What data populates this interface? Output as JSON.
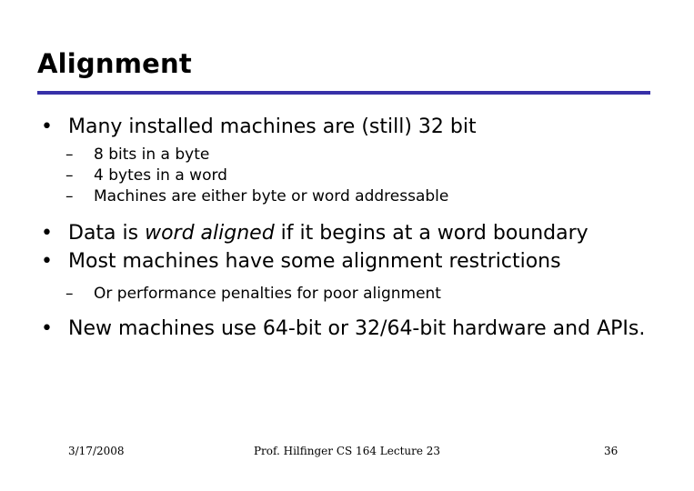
{
  "slide": {
    "title": "Alignment",
    "rule_color": "#3730a8",
    "background_color": "#ffffff",
    "text_color": "#000000",
    "bullet_marker": "•",
    "sub_bullet_marker": "–",
    "bullets": [
      {
        "level": 1,
        "text": "Many installed machines are (still) 32 bit"
      },
      {
        "level": 2,
        "text": "8 bits in a byte"
      },
      {
        "level": 2,
        "text": "4 bytes in a word"
      },
      {
        "level": 2,
        "text": "Machines are either byte or word addressable"
      },
      {
        "level": 1,
        "text_before_italic": "Data is ",
        "italic_text": "word aligned",
        "text_after_italic": " if it begins at a word boundary"
      },
      {
        "level": 1,
        "text": "Most machines have some alignment restrictions"
      },
      {
        "level": 2,
        "text": "Or performance penalties for poor alignment"
      },
      {
        "level": 1,
        "text": "New machines use 64-bit or 32/64-bit hardware and APIs."
      }
    ]
  },
  "footer": {
    "date": "3/17/2008",
    "center": "Prof. Hilfinger  CS 164  Lecture 23",
    "page_number": "36"
  }
}
